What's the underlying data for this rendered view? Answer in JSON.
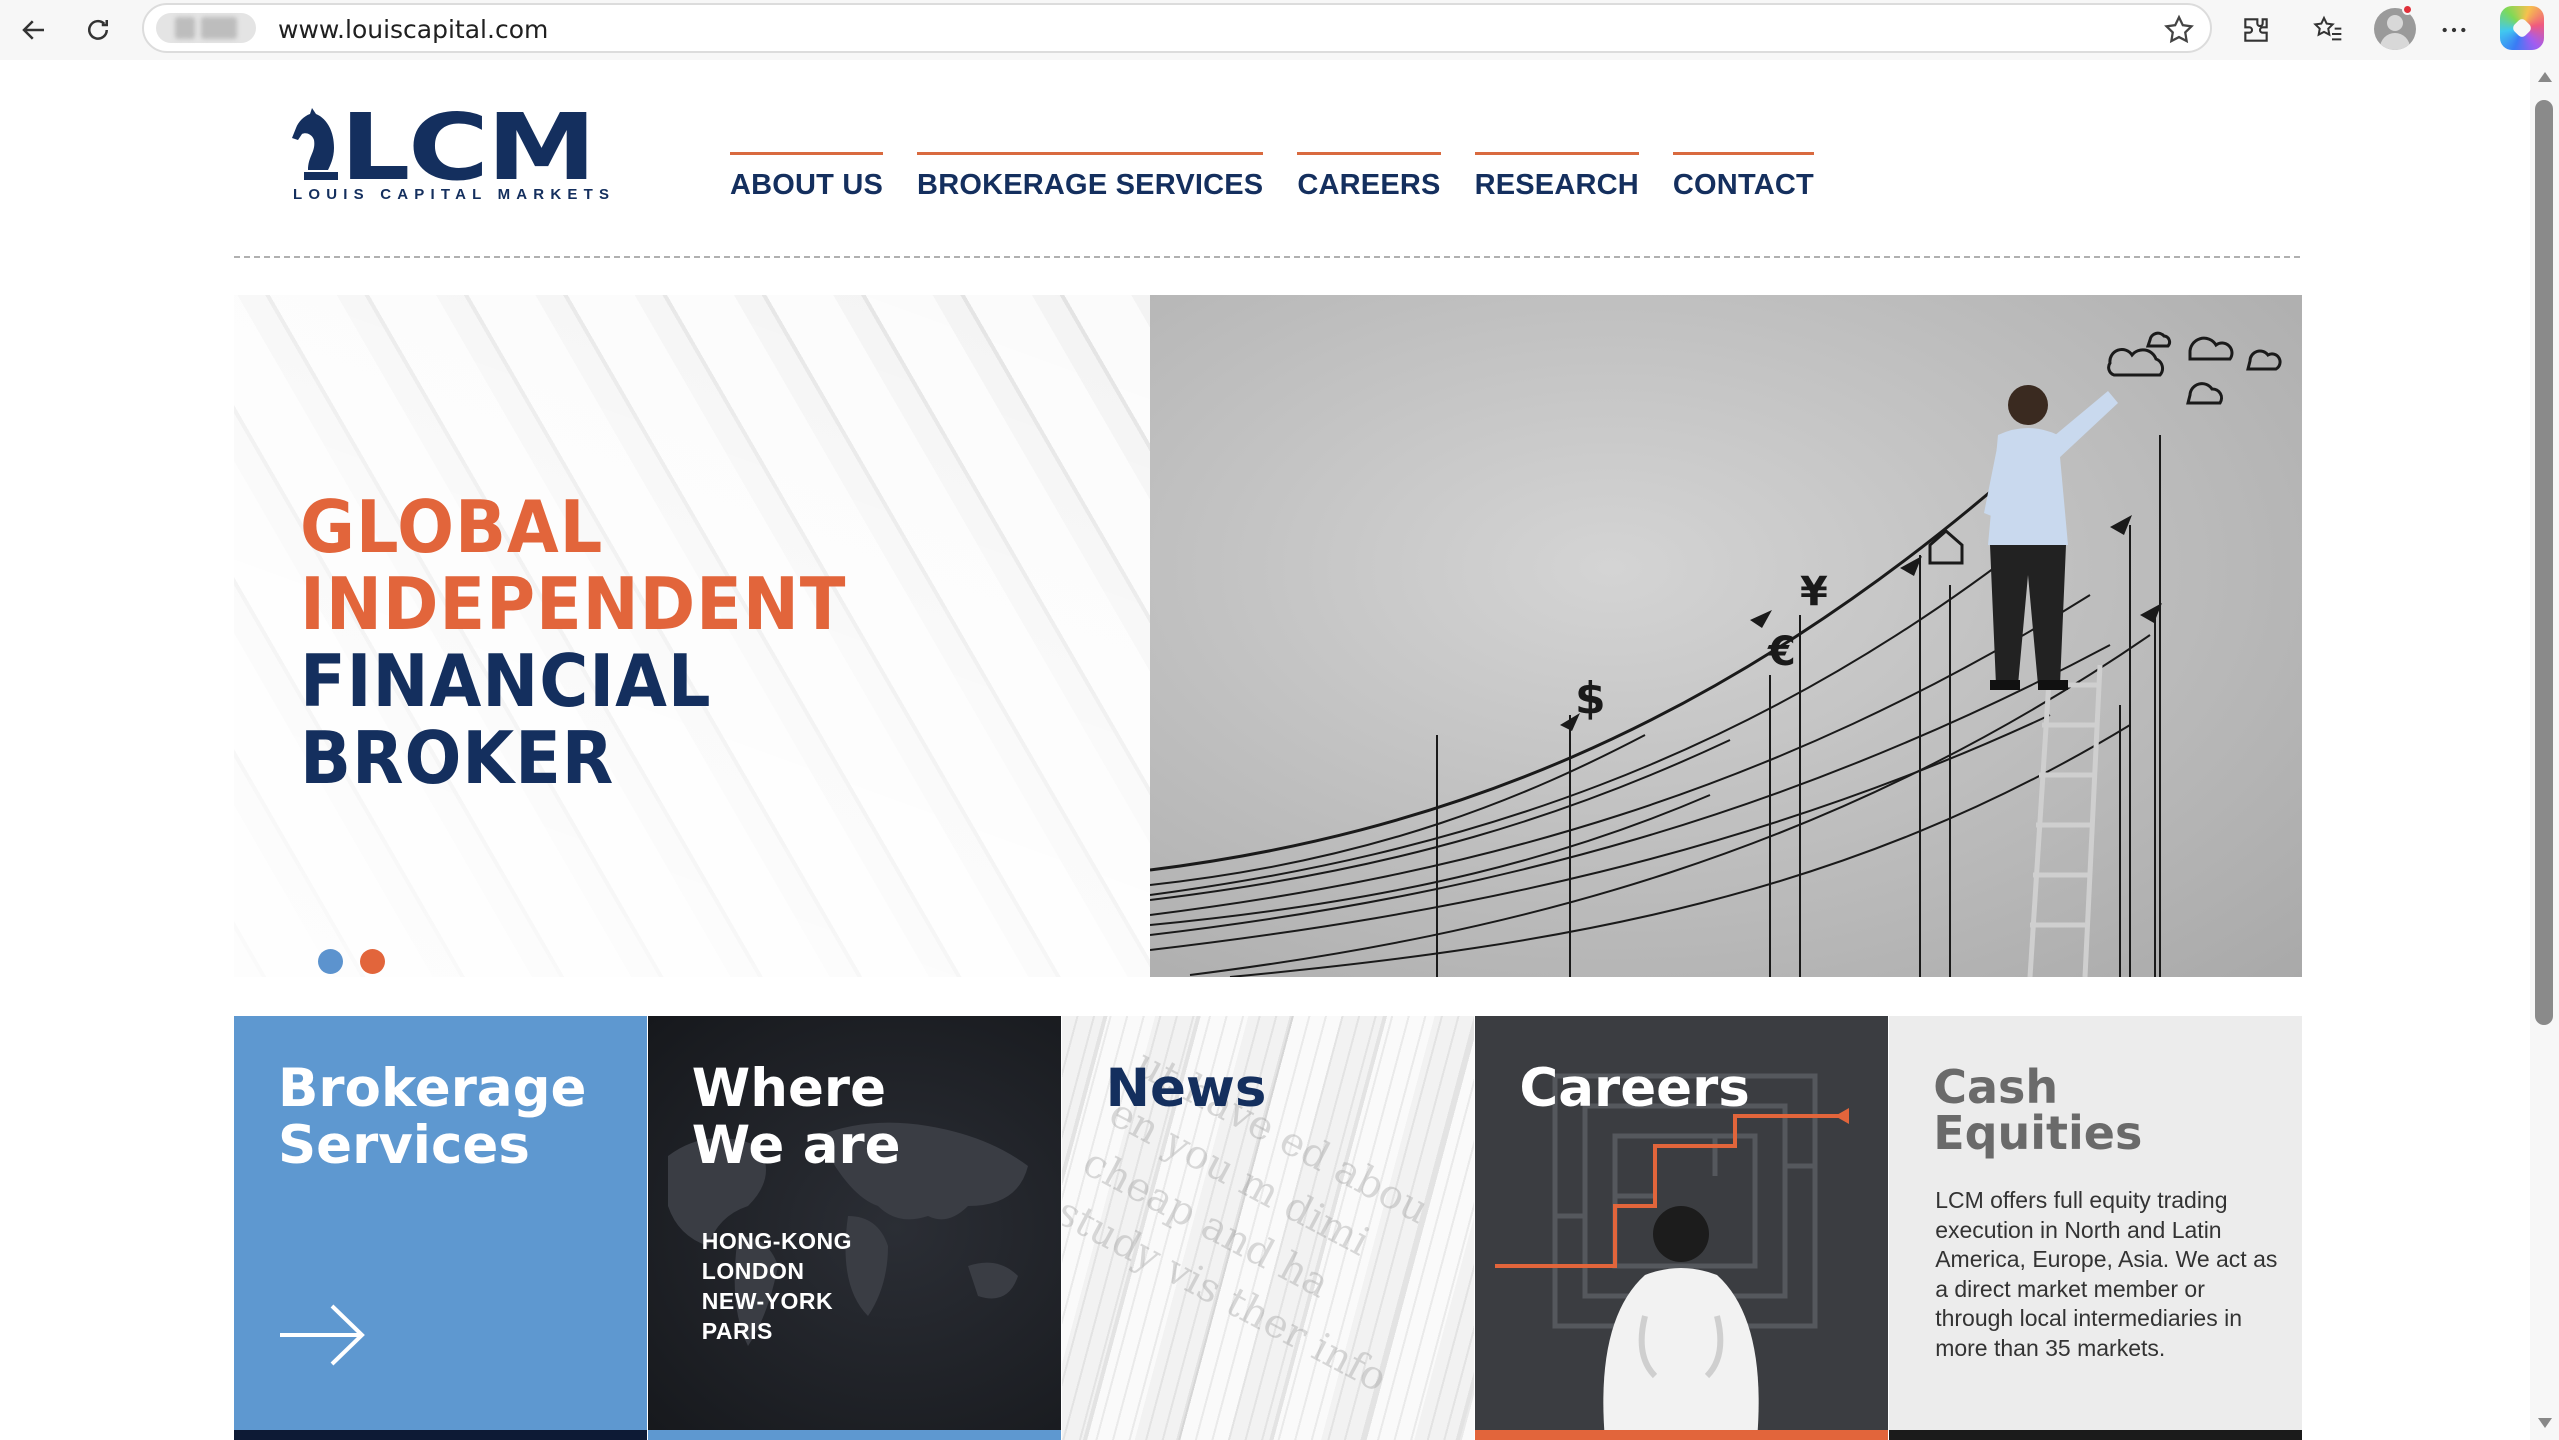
{
  "browser": {
    "url": "www.louiscapital.com"
  },
  "logo": {
    "mark": "LCM",
    "tagline": "LOUIS CAPITAL MARKETS"
  },
  "nav": {
    "items": [
      {
        "label": "ABOUT US"
      },
      {
        "label": "BROKERAGE SERVICES"
      },
      {
        "label": "CAREERS"
      },
      {
        "label": "RESEARCH"
      },
      {
        "label": "CONTACT"
      }
    ]
  },
  "hero": {
    "line1": "GLOBAL",
    "line2": "INDEPENDENT",
    "line3": "FINANCIAL",
    "line4": "BROKER",
    "slides": 2
  },
  "tiles": {
    "brokerage": {
      "line1": "Brokerage",
      "line2": "Services"
    },
    "where": {
      "line1": "Where",
      "line2": "We are",
      "cities": [
        "HONG-KONG",
        "LONDON",
        "NEW-YORK",
        "PARIS"
      ]
    },
    "news": {
      "title": "News"
    },
    "careers": {
      "title": "Careers"
    },
    "cash": {
      "line1": "Cash",
      "line2": "Equities",
      "description": "LCM offers full equity trading execution in North and Latin America, Europe, Asia. We act as a direct market member or through local intermediaries in more than 35 markets."
    }
  },
  "colors": {
    "navy": "#142f5e",
    "orange": "#e2653b",
    "blue": "#5e98d0"
  }
}
